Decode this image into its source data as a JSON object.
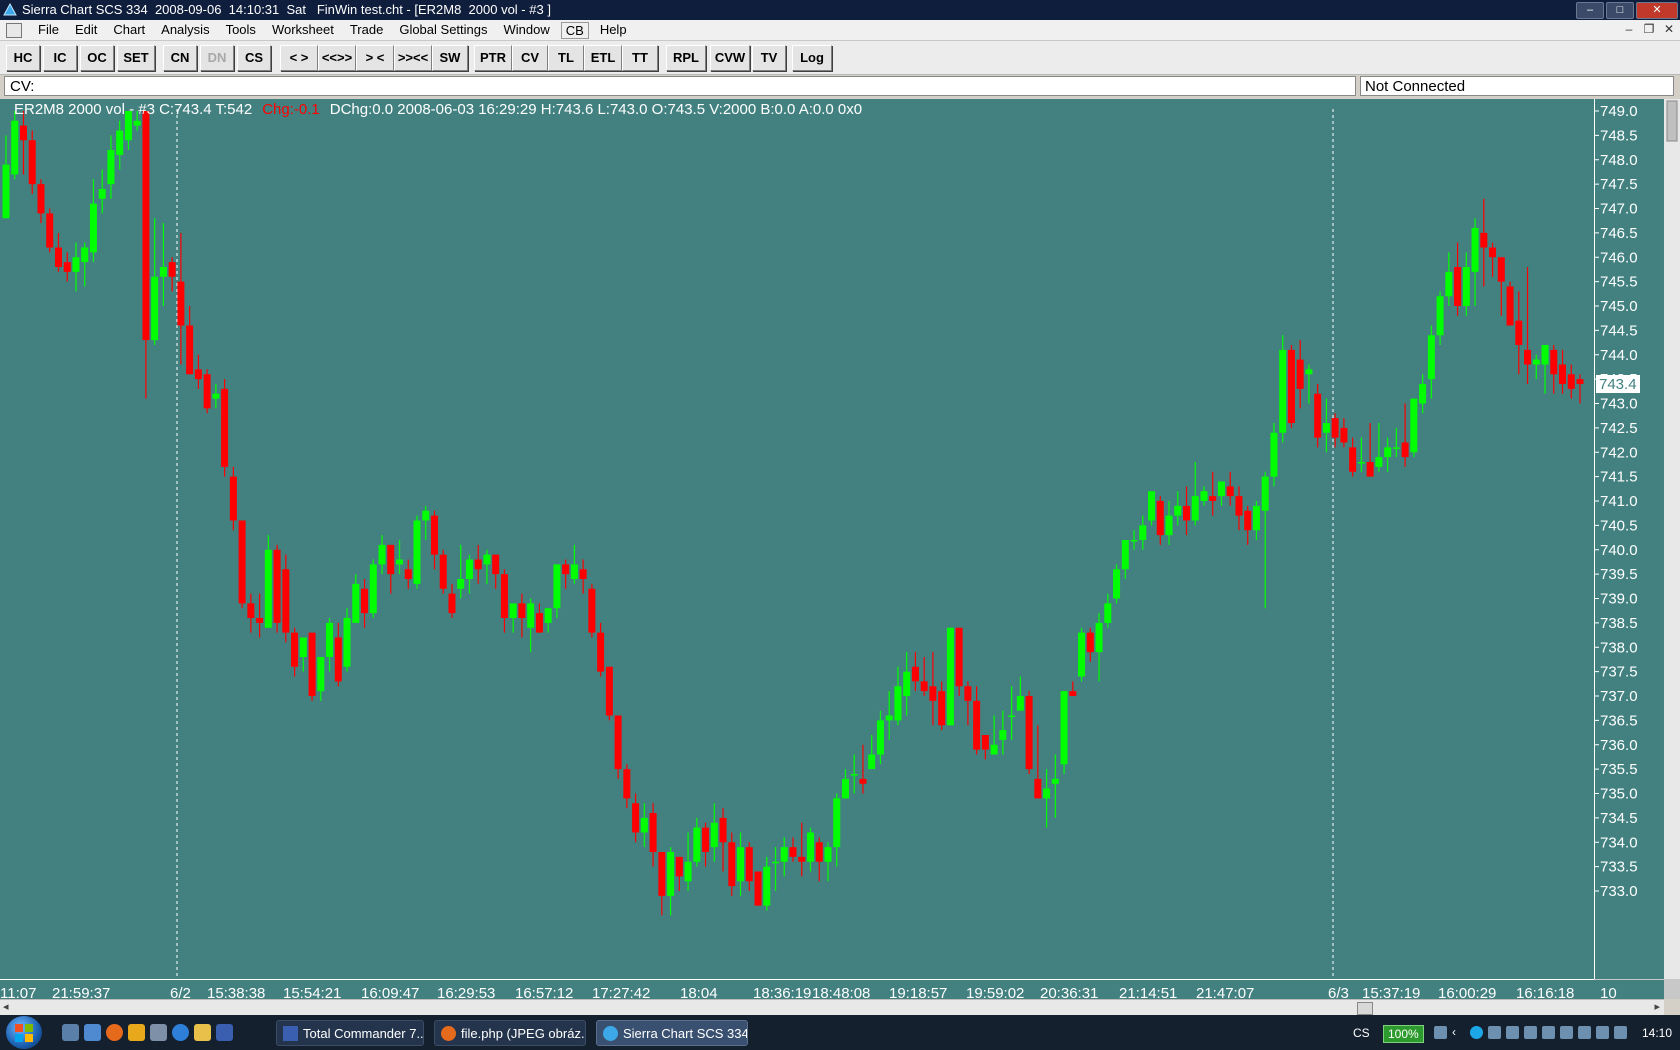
{
  "window": {
    "title": "Sierra Chart SCS 334  2008-09-06  14:10:31  Sat   FinWin test.cht - [ER2M8  2000 vol - #3 ]",
    "buttons": [
      "–",
      "□",
      "✕"
    ],
    "mdi_buttons": [
      "–",
      "❐",
      "✕"
    ]
  },
  "menu": [
    "File",
    "Edit",
    "Chart",
    "Analysis",
    "Tools",
    "Worksheet",
    "Trade",
    "Global Settings",
    "Window",
    "CB",
    "Help"
  ],
  "toolbar": [
    {
      "label": "HC",
      "enabled": true
    },
    {
      "label": "IC",
      "enabled": true
    },
    {
      "label": "OC",
      "enabled": true
    },
    {
      "label": "SET",
      "enabled": true
    },
    {
      "label": "CN",
      "enabled": true
    },
    {
      "label": "DN",
      "enabled": false
    },
    {
      "label": "CS",
      "enabled": true
    },
    {
      "label": "< >",
      "enabled": true
    },
    {
      "label": "<<>>",
      "enabled": true
    },
    {
      "label": "> <",
      "enabled": true
    },
    {
      "label": ">><<",
      "enabled": true
    },
    {
      "label": "SW",
      "enabled": true
    },
    {
      "label": "PTR",
      "enabled": true
    },
    {
      "label": "CV",
      "enabled": true
    },
    {
      "label": "TL",
      "enabled": true
    },
    {
      "label": "ETL",
      "enabled": true
    },
    {
      "label": "TT",
      "enabled": true
    },
    {
      "label": "RPL",
      "enabled": true
    },
    {
      "label": "CVW",
      "enabled": true
    },
    {
      "label": "TV",
      "enabled": true
    },
    {
      "label": "Log",
      "enabled": true
    }
  ],
  "cv_bar": {
    "label": "CV:",
    "status": "Not Connected"
  },
  "chart_info": {
    "prefix": "ER2M8  2000 vol - #3   C:743.4   T:542",
    "change": "Chg:-0.1",
    "suffix": "DChg:0.0   2008-06-03   16:29:29   H:743.6   L:743.0   O:743.5   V:2000   B:0.0   A:0.0   0x0"
  },
  "chart_data": {
    "type": "candlestick",
    "symbol": "ER2M8",
    "ylim": [
      732.5,
      749.2
    ],
    "y_ticks": [
      "749.0",
      "748.5",
      "748.0",
      "747.5",
      "747.0",
      "746.5",
      "746.0",
      "745.5",
      "745.0",
      "744.5",
      "744.0",
      "743.5",
      "743.0",
      "742.5",
      "742.0",
      "741.5",
      "741.0",
      "740.5",
      "740.0",
      "739.5",
      "739.0",
      "738.5",
      "738.0",
      "737.5",
      "737.0",
      "736.5",
      "736.0",
      "735.5",
      "735.0",
      "734.5",
      "734.0",
      "733.5",
      "733.0"
    ],
    "last_price": "743.4",
    "last_value": 743.4,
    "x_ticks": [
      "11:07",
      "21:59:37",
      "6/2",
      "15:38:38",
      "15:54:21",
      "16:09:47",
      "16:29:53",
      "16:57:12",
      "17:27:42",
      "18:04",
      "18:36:19",
      "18:48:08",
      "19:18:57",
      "19:59:02",
      "20:36:31",
      "21:14:51",
      "21:47:07",
      "6/3",
      "15:37:19",
      "16:00:29",
      "16:16:18",
      "10"
    ],
    "session_breaks": [
      "6/2",
      "6/3"
    ],
    "background": "#438181",
    "up_color": "#00ff00",
    "down_color": "#ff0000",
    "candles": [
      [
        746.8,
        747.9,
        746.8,
        748.5
      ],
      [
        747.7,
        748.8,
        747.6,
        749.0
      ],
      [
        748.7,
        748.4,
        747.7,
        749.0
      ],
      [
        748.4,
        747.5,
        747.3,
        748.6
      ],
      [
        747.5,
        746.9,
        746.7,
        747.6
      ],
      [
        746.9,
        746.2,
        746.1,
        747.0
      ],
      [
        746.2,
        745.8,
        745.7,
        746.5
      ],
      [
        745.9,
        745.7,
        745.5,
        746.1
      ],
      [
        745.7,
        746.0,
        745.3,
        746.3
      ],
      [
        745.9,
        746.2,
        745.4,
        746.3
      ],
      [
        746.1,
        747.1,
        745.9,
        747.6
      ],
      [
        747.2,
        747.4,
        746.9,
        747.8
      ],
      [
        747.5,
        748.2,
        747.2,
        748.5
      ],
      [
        748.1,
        748.6,
        747.8,
        748.8
      ],
      [
        748.4,
        749.0,
        748.2,
        749.0
      ],
      [
        748.7,
        748.8,
        748.6,
        749.0
      ],
      [
        749.0,
        744.3,
        743.1,
        749.0
      ],
      [
        744.3,
        745.6,
        744.2,
        746.8
      ],
      [
        745.6,
        745.8,
        745.0,
        746.7
      ],
      [
        745.9,
        745.6,
        745.3,
        746.0
      ],
      [
        745.5,
        744.6,
        743.8,
        746.5
      ],
      [
        744.6,
        743.6,
        743.6,
        745.0
      ],
      [
        743.7,
        743.5,
        743.3,
        744.0
      ],
      [
        743.6,
        742.9,
        742.8,
        743.7
      ],
      [
        743.1,
        743.2,
        742.9,
        743.4
      ],
      [
        743.3,
        741.7,
        741.5,
        743.5
      ],
      [
        741.5,
        740.6,
        740.4,
        741.7
      ],
      [
        740.6,
        738.9,
        738.8,
        740.6
      ],
      [
        738.9,
        738.6,
        738.3,
        739.1
      ],
      [
        738.6,
        738.5,
        738.2,
        739.1
      ],
      [
        738.4,
        740.0,
        738.4,
        740.3
      ],
      [
        740.0,
        738.5,
        738.3,
        740.1
      ],
      [
        739.6,
        738.3,
        738.1,
        739.9
      ],
      [
        738.3,
        737.6,
        737.4,
        738.4
      ],
      [
        737.8,
        738.2,
        737.5,
        738.2
      ],
      [
        738.3,
        737.0,
        736.9,
        738.2
      ],
      [
        737.1,
        737.8,
        736.9,
        737.8
      ],
      [
        737.8,
        738.5,
        737.5,
        738.6
      ],
      [
        738.2,
        737.3,
        737.2,
        738.5
      ],
      [
        737.6,
        738.6,
        737.5,
        738.8
      ],
      [
        738.5,
        739.3,
        738.5,
        739.5
      ],
      [
        739.2,
        738.7,
        738.4,
        739.4
      ],
      [
        738.7,
        739.7,
        738.6,
        739.8
      ],
      [
        739.7,
        740.1,
        739.5,
        740.3
      ],
      [
        740.1,
        739.5,
        739.1,
        740.1
      ],
      [
        739.7,
        739.8,
        739.5,
        740.2
      ],
      [
        739.6,
        739.4,
        739.2,
        739.8
      ],
      [
        739.3,
        740.6,
        739.2,
        740.7
      ],
      [
        740.6,
        740.8,
        740.2,
        740.9
      ],
      [
        740.7,
        739.9,
        739.6,
        740.8
      ],
      [
        739.9,
        739.2,
        739.1,
        740.0
      ],
      [
        739.1,
        738.7,
        738.6,
        739.3
      ],
      [
        739.2,
        739.4,
        739.0,
        740.1
      ],
      [
        739.4,
        739.8,
        739.1,
        739.9
      ],
      [
        739.8,
        739.6,
        739.3,
        740.1
      ],
      [
        739.7,
        739.9,
        739.3,
        740.0
      ],
      [
        739.9,
        739.5,
        739.2,
        739.9
      ],
      [
        739.5,
        738.6,
        738.3,
        739.6
      ],
      [
        738.6,
        738.9,
        738.3,
        738.9
      ],
      [
        738.9,
        738.6,
        738.2,
        739.1
      ],
      [
        738.4,
        738.9,
        737.9,
        739.0
      ],
      [
        738.7,
        738.3,
        738.3,
        738.9
      ],
      [
        738.5,
        738.8,
        738.3,
        738.8
      ],
      [
        738.8,
        739.7,
        738.6,
        739.7
      ],
      [
        739.7,
        739.5,
        739.2,
        739.8
      ],
      [
        739.4,
        739.7,
        739.3,
        740.1
      ],
      [
        739.6,
        739.4,
        739.1,
        739.8
      ],
      [
        739.2,
        738.3,
        738.2,
        739.3
      ],
      [
        738.3,
        737.5,
        737.4,
        738.5
      ],
      [
        737.6,
        736.6,
        736.5,
        737.6
      ],
      [
        736.6,
        735.5,
        735.3,
        736.6
      ],
      [
        735.5,
        734.9,
        734.7,
        735.6
      ],
      [
        734.8,
        734.2,
        734.0,
        735.0
      ],
      [
        734.2,
        734.5,
        733.9,
        734.8
      ],
      [
        734.6,
        733.8,
        733.5,
        734.8
      ],
      [
        733.8,
        732.9,
        732.5,
        733.8
      ],
      [
        732.9,
        733.8,
        732.5,
        733.9
      ],
      [
        733.7,
        733.3,
        733.0,
        733.7
      ],
      [
        733.2,
        733.6,
        733.0,
        734.2
      ],
      [
        733.6,
        734.3,
        733.5,
        734.5
      ],
      [
        734.3,
        733.8,
        733.5,
        734.4
      ],
      [
        733.9,
        734.4,
        733.6,
        734.8
      ],
      [
        734.5,
        734.0,
        733.4,
        734.7
      ],
      [
        734.0,
        733.1,
        732.9,
        734.2
      ],
      [
        733.2,
        733.9,
        732.9,
        734.2
      ],
      [
        733.9,
        733.2,
        733.0,
        734.0
      ],
      [
        733.4,
        732.7,
        732.7,
        733.4
      ],
      [
        732.7,
        733.5,
        732.6,
        733.7
      ],
      [
        733.6,
        733.6,
        733.0,
        733.9
      ],
      [
        733.6,
        733.9,
        733.3,
        734.1
      ],
      [
        733.9,
        733.7,
        733.6,
        734.1
      ],
      [
        733.7,
        733.6,
        733.3,
        734.4
      ],
      [
        733.6,
        734.2,
        733.4,
        734.3
      ],
      [
        734.0,
        733.6,
        733.2,
        734.1
      ],
      [
        733.6,
        733.9,
        733.2,
        734.0
      ],
      [
        733.9,
        734.9,
        733.5,
        735.0
      ],
      [
        734.9,
        735.3,
        734.9,
        735.5
      ],
      [
        735.4,
        735.4,
        735.0,
        735.8
      ],
      [
        735.3,
        735.2,
        735.0,
        736.0
      ],
      [
        735.5,
        735.8,
        735.5,
        736.2
      ],
      [
        735.8,
        736.5,
        735.6,
        736.7
      ],
      [
        736.5,
        736.6,
        736.1,
        737.1
      ],
      [
        736.5,
        737.2,
        736.4,
        737.6
      ],
      [
        737.0,
        737.5,
        736.6,
        737.9
      ],
      [
        737.6,
        737.3,
        737.1,
        737.9
      ],
      [
        737.3,
        737.1,
        737.0,
        737.8
      ],
      [
        737.2,
        736.9,
        736.4,
        737.9
      ],
      [
        737.1,
        736.4,
        736.3,
        737.3
      ],
      [
        736.4,
        738.4,
        736.4,
        738.4
      ],
      [
        738.4,
        737.2,
        737.0,
        738.4
      ],
      [
        737.2,
        736.9,
        736.4,
        737.3
      ],
      [
        736.9,
        735.9,
        735.8,
        737.2
      ],
      [
        736.2,
        735.9,
        735.7,
        736.2
      ],
      [
        735.8,
        736.0,
        735.8,
        736.6
      ],
      [
        736.1,
        736.3,
        735.8,
        736.7
      ],
      [
        736.6,
        736.6,
        736.1,
        737.2
      ],
      [
        736.7,
        737.0,
        736.7,
        737.4
      ],
      [
        737.0,
        735.5,
        735.4,
        737.1
      ],
      [
        735.3,
        734.9,
        734.9,
        736.4
      ],
      [
        734.9,
        735.1,
        734.3,
        735.5
      ],
      [
        735.2,
        735.3,
        734.5,
        735.8
      ],
      [
        735.6,
        737.1,
        735.4,
        737.1
      ],
      [
        737.1,
        737.0,
        737.0,
        737.3
      ],
      [
        737.4,
        738.3,
        737.3,
        738.4
      ],
      [
        738.3,
        737.9,
        737.7,
        738.4
      ],
      [
        737.9,
        738.5,
        737.3,
        738.7
      ],
      [
        738.5,
        738.9,
        738.4,
        739.1
      ],
      [
        739.0,
        739.6,
        738.9,
        739.7
      ],
      [
        739.6,
        740.2,
        739.4,
        740.2
      ],
      [
        740.2,
        740.2,
        740.0,
        740.4
      ],
      [
        740.2,
        740.5,
        740.0,
        740.7
      ],
      [
        740.6,
        741.2,
        740.5,
        741.2
      ],
      [
        741.0,
        740.3,
        740.1,
        741.1
      ],
      [
        740.3,
        740.7,
        740.1,
        741.0
      ],
      [
        740.7,
        740.9,
        740.5,
        741.2
      ],
      [
        740.9,
        740.6,
        740.3,
        741.3
      ],
      [
        740.6,
        741.1,
        740.5,
        741.8
      ],
      [
        741.0,
        741.2,
        740.9,
        741.3
      ],
      [
        741.1,
        741.0,
        740.7,
        741.6
      ],
      [
        741.1,
        741.4,
        740.9,
        741.4
      ],
      [
        741.3,
        741.1,
        740.9,
        741.6
      ],
      [
        741.1,
        740.7,
        740.4,
        741.3
      ],
      [
        740.8,
        740.4,
        740.1,
        740.9
      ],
      [
        740.4,
        740.9,
        740.2,
        741.0
      ],
      [
        740.8,
        741.5,
        738.8,
        741.6
      ],
      [
        741.5,
        742.4,
        741.3,
        742.6
      ],
      [
        742.4,
        744.1,
        742.2,
        744.4
      ],
      [
        744.1,
        742.6,
        742.5,
        744.2
      ],
      [
        743.9,
        743.3,
        742.9,
        744.3
      ],
      [
        743.6,
        743.7,
        743.0,
        743.8
      ],
      [
        743.2,
        742.3,
        742.1,
        743.4
      ],
      [
        742.4,
        742.6,
        742.0,
        743.1
      ],
      [
        742.7,
        742.3,
        742.1,
        742.8
      ],
      [
        742.5,
        742.2,
        742.1,
        742.7
      ],
      [
        742.1,
        741.6,
        741.5,
        742.3
      ],
      [
        741.8,
        741.8,
        741.6,
        742.3
      ],
      [
        741.8,
        741.5,
        741.5,
        742.6
      ],
      [
        741.7,
        741.9,
        741.6,
        742.6
      ],
      [
        741.9,
        742.1,
        741.6,
        742.3
      ],
      [
        742.1,
        742.1,
        741.9,
        742.5
      ],
      [
        742.2,
        741.9,
        741.7,
        743.0
      ],
      [
        742.0,
        743.1,
        741.9,
        743.1
      ],
      [
        743.0,
        743.4,
        742.8,
        743.6
      ],
      [
        743.5,
        744.4,
        743.1,
        744.6
      ],
      [
        744.4,
        745.2,
        744.2,
        745.3
      ],
      [
        745.2,
        745.7,
        745.0,
        746.1
      ],
      [
        745.8,
        745.0,
        744.8,
        746.3
      ],
      [
        745.0,
        745.8,
        744.8,
        746.1
      ],
      [
        745.7,
        746.6,
        745.0,
        746.8
      ],
      [
        746.5,
        746.2,
        745.4,
        747.2
      ],
      [
        746.2,
        746.0,
        745.6,
        746.3
      ],
      [
        746.0,
        745.5,
        744.8,
        746.0
      ],
      [
        745.4,
        744.6,
        744.6,
        745.5
      ],
      [
        744.7,
        744.2,
        743.6,
        745.3
      ],
      [
        744.1,
        743.8,
        743.4,
        745.8
      ],
      [
        743.8,
        743.9,
        743.5,
        744.0
      ],
      [
        743.8,
        744.2,
        743.2,
        744.2
      ],
      [
        744.1,
        743.6,
        743.2,
        744.2
      ],
      [
        743.8,
        743.4,
        743.2,
        744.1
      ],
      [
        743.6,
        743.3,
        743.1,
        743.8
      ],
      [
        743.5,
        743.4,
        743.0,
        743.6
      ]
    ]
  },
  "taskbar": {
    "tasks": [
      "Total Commander 7...",
      "file.php (JPEG obráz...",
      "Sierra Chart SCS 334..."
    ],
    "lang": "CS",
    "zoom": "100%",
    "clock": "14:10"
  }
}
